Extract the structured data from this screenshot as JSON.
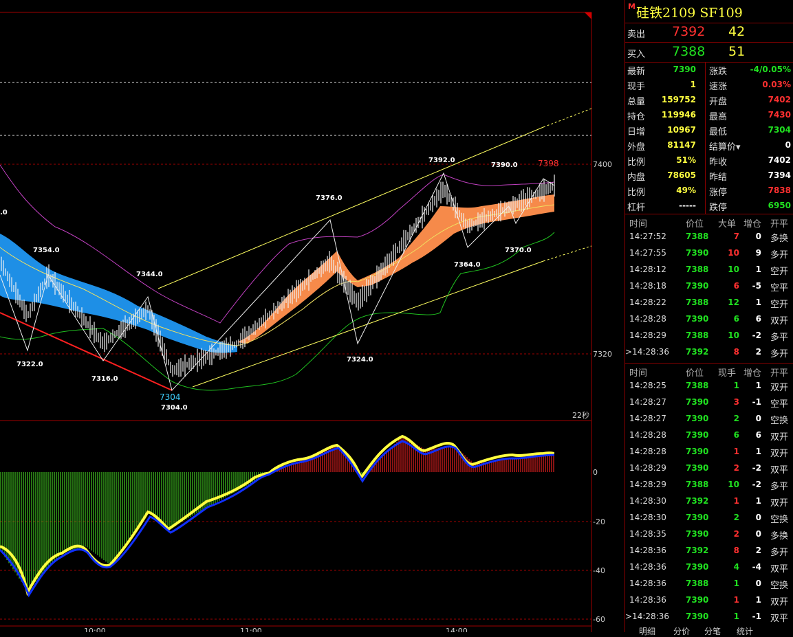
{
  "chart": {
    "price_levels": [
      {
        "label": "7400",
        "value": 7400
      },
      {
        "label": "7320",
        "value": 7320
      }
    ],
    "macd_levels": [
      {
        "label": "0",
        "value": 0
      },
      {
        "label": "-20",
        "value": -20
      },
      {
        "label": "-40",
        "value": -40
      },
      {
        "label": "-60",
        "value": -60
      }
    ],
    "annotations": [
      {
        "text": "7354.0"
      },
      {
        "text": "7344.0"
      },
      {
        "text": "7322.0"
      },
      {
        "text": "7316.0"
      },
      {
        "text": "7304",
        "color": "cyan"
      },
      {
        "text": "7304.0"
      },
      {
        "text": "7376.0"
      },
      {
        "text": "7392.0"
      },
      {
        "text": "7390.0"
      },
      {
        "text": "7398",
        "color": "red"
      },
      {
        "text": "7364.0"
      },
      {
        "text": "7370.0"
      },
      {
        "text": "7324.0"
      },
      {
        "text": ".0"
      }
    ],
    "countdown": "22秒",
    "time_labels": [
      "10:00",
      "11:00",
      "14:00"
    ]
  },
  "panel": {
    "marker": "M",
    "title": "硅铁2109  SF109",
    "sell": {
      "label": "卖出",
      "price": "7392",
      "volume": "42"
    },
    "buy": {
      "label": "买入",
      "price": "7388",
      "volume": "51"
    },
    "stats": [
      {
        "l": "最新",
        "lv": "7390",
        "lc": "green",
        "r": "涨跌",
        "rv": "-4/0.05%",
        "rc": "green"
      },
      {
        "l": "现手",
        "lv": "1",
        "lc": "yellow",
        "r": "速涨",
        "rv": "0.03%",
        "rc": "red"
      },
      {
        "l": "总量",
        "lv": "159752",
        "lc": "yellow",
        "r": "开盘",
        "rv": "7402",
        "rc": "red"
      },
      {
        "l": "持仓",
        "lv": "119946",
        "lc": "yellow",
        "r": "最高",
        "rv": "7430",
        "rc": "red"
      },
      {
        "l": "日增",
        "lv": "10967",
        "lc": "yellow",
        "r": "最低",
        "rv": "7304",
        "rc": "green"
      },
      {
        "l": "外盘",
        "lv": "81147",
        "lc": "yellow",
        "r": "结算价▾",
        "rv": "0",
        "rc": "white"
      },
      {
        "l": "比例",
        "lv": "51%",
        "lc": "yellow",
        "r": "昨收",
        "rv": "7402",
        "rc": "white"
      },
      {
        "l": "内盘",
        "lv": "78605",
        "lc": "yellow",
        "r": "昨结",
        "rv": "7394",
        "rc": "white"
      },
      {
        "l": "比例",
        "lv": "49%",
        "lc": "yellow",
        "r": "涨停",
        "rv": "7838",
        "rc": "red"
      },
      {
        "l": "杠杆",
        "lv": "-----",
        "lc": "white",
        "r": "跌停",
        "rv": "6950",
        "rc": "green"
      }
    ],
    "table1": {
      "headers": [
        "时间",
        "价位",
        "大单",
        "增仓",
        "开平"
      ],
      "rows": [
        {
          "time": "14:27:52",
          "price": "7388",
          "big": "7",
          "bc": "red",
          "inc": "0",
          "kp": "多换"
        },
        {
          "time": "14:27:55",
          "price": "7390",
          "big": "10",
          "bc": "red",
          "inc": "9",
          "kp": "多开"
        },
        {
          "time": "14:28:12",
          "price": "7388",
          "big": "10",
          "bc": "green",
          "inc": "1",
          "kp": "空开"
        },
        {
          "time": "14:28:18",
          "price": "7390",
          "big": "6",
          "bc": "red",
          "inc": "-5",
          "kp": "空平"
        },
        {
          "time": "14:28:22",
          "price": "7388",
          "big": "12",
          "bc": "green",
          "inc": "1",
          "kp": "空开"
        },
        {
          "time": "14:28:28",
          "price": "7390",
          "big": "6",
          "bc": "green",
          "inc": "6",
          "kp": "双开"
        },
        {
          "time": "14:28:29",
          "price": "7388",
          "big": "10",
          "bc": "green",
          "inc": "-2",
          "kp": "多平"
        },
        {
          "time": ">14:28:36",
          "price": "7392",
          "big": "8",
          "bc": "red",
          "inc": "2",
          "kp": "多开"
        }
      ]
    },
    "table2": {
      "headers": [
        "时间",
        "价位",
        "现手",
        "增仓",
        "开平"
      ],
      "rows": [
        {
          "time": "14:28:25",
          "price": "7388",
          "big": "1",
          "bc": "green",
          "inc": "1",
          "kp": "双开"
        },
        {
          "time": "14:28:27",
          "price": "7390",
          "big": "3",
          "bc": "red",
          "inc": "-1",
          "kp": "空平"
        },
        {
          "time": "14:28:27",
          "price": "7390",
          "big": "2",
          "bc": "green",
          "inc": "0",
          "kp": "空换"
        },
        {
          "time": "14:28:28",
          "price": "7390",
          "big": "6",
          "bc": "green",
          "inc": "6",
          "kp": "双开"
        },
        {
          "time": "14:28:28",
          "price": "7390",
          "big": "1",
          "bc": "red",
          "inc": "1",
          "kp": "双开"
        },
        {
          "time": "14:28:29",
          "price": "7390",
          "big": "2",
          "bc": "red",
          "inc": "-2",
          "kp": "双平"
        },
        {
          "time": "14:28:29",
          "price": "7388",
          "big": "10",
          "bc": "green",
          "inc": "-2",
          "kp": "多平"
        },
        {
          "time": "14:28:30",
          "price": "7392",
          "big": "1",
          "bc": "red",
          "inc": "1",
          "kp": "双开"
        },
        {
          "time": "14:28:30",
          "price": "7390",
          "big": "2",
          "bc": "green",
          "inc": "0",
          "kp": "空换"
        },
        {
          "time": "14:28:35",
          "price": "7390",
          "big": "2",
          "bc": "red",
          "inc": "0",
          "kp": "多换"
        },
        {
          "time": "14:28:36",
          "price": "7392",
          "big": "8",
          "bc": "red",
          "inc": "2",
          "kp": "多开"
        },
        {
          "time": "14:28:36",
          "price": "7390",
          "big": "4",
          "bc": "green",
          "inc": "-4",
          "kp": "双平"
        },
        {
          "time": "14:28:36",
          "price": "7388",
          "big": "1",
          "bc": "green",
          "inc": "0",
          "kp": "空换"
        },
        {
          "time": "14:28:36",
          "price": "7390",
          "big": "1",
          "bc": "red",
          "inc": "1",
          "kp": "双开"
        },
        {
          "time": ">14:28:36",
          "price": "7390",
          "big": "1",
          "bc": "green",
          "inc": "-1",
          "kp": "双平"
        }
      ]
    },
    "tabs": [
      "明细",
      "分价",
      "分笔",
      "统计"
    ]
  }
}
